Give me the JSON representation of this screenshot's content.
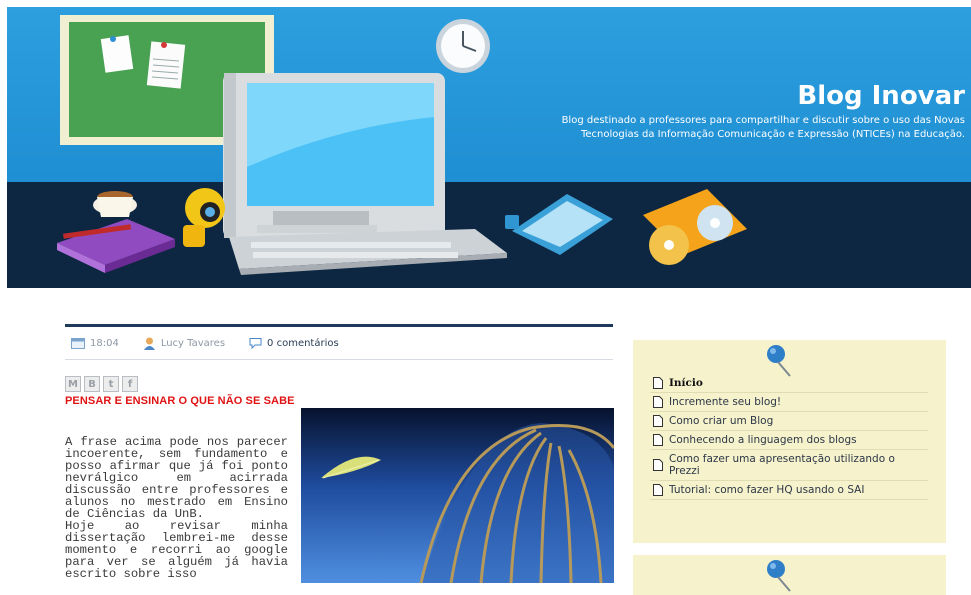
{
  "header": {
    "title": "Blog Inovar",
    "description": "Blog destinado a professores para compartilhar e discutir sobre o uso das Novas Tecnologias da Informação Comunicação e Expressão (NTICEs) na Educação."
  },
  "post": {
    "time": "18:04",
    "author": "Lucy Tavares",
    "comments": "0 comentários",
    "share_icons": [
      "email-icon",
      "blogger-icon",
      "twitter-icon",
      "facebook-icon"
    ],
    "title": "PENSAR E ENSINAR O QUE NÃO SE SABE",
    "body_p1": "A frase acima pode nos parecer incoerente, sem fundamento e posso afirmar que já foi ponto nevrálgico em acirrada discussão entre professores e alunos no mestrado em Ensino de Ciências da UnB.",
    "body_p2": "Hoje ao revisar minha dissertação lembrei-me desse momento e recorri ao google para ver se alguém já havia escrito sobre isso"
  },
  "sidebar": {
    "pages": [
      {
        "label": "Início",
        "active": true
      },
      {
        "label": "Incremente seu blog!"
      },
      {
        "label": "Como criar um Blog"
      },
      {
        "label": "Conhecendo a linguagem dos blogs"
      },
      {
        "label": "Como fazer uma apresentação utilizando o Prezzi"
      },
      {
        "label": "Tutorial: como fazer HQ usando o SAI"
      }
    ]
  },
  "colors": {
    "header_sky": "#1f8fd3",
    "header_band": "#0d2742",
    "post_title": "#e11212",
    "widget_bg": "#f5f2cc"
  }
}
